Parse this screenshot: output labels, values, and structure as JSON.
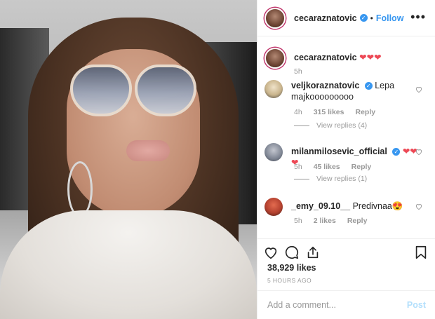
{
  "post": {
    "author": "cecaraznatovic",
    "verified_mark": "✓",
    "separator": "•",
    "follow_label": "Follow",
    "more_label": "•••",
    "caption_text": "❤❤❤",
    "caption_age": "5h"
  },
  "comments": [
    {
      "user": "veljkoraznatovic",
      "text": "Lepa majkooooooooo",
      "age": "4h",
      "likes": "315 likes",
      "reply": "Reply",
      "view_replies": "View replies (4)"
    },
    {
      "user": "milanmilosevic_official",
      "text": "❤❤❤",
      "age": "5h",
      "likes": "45 likes",
      "reply": "Reply",
      "view_replies": "View replies (1)"
    },
    {
      "user": "_emy_09.10__",
      "text": "Predivnaa😍",
      "age": "5h",
      "likes": "2 likes",
      "reply": "Reply"
    }
  ],
  "stats": {
    "likes": "38,929 likes",
    "time_ago": "5 HOURS AGO"
  },
  "add_comment": {
    "placeholder": "Add a comment...",
    "post_label": "Post"
  },
  "icons": [
    "heart-icon",
    "comment-icon",
    "share-icon",
    "bookmark-icon",
    "verified-icon",
    "more-icon"
  ],
  "colors": {
    "accent": "#3897f0",
    "heart": "#ed4956",
    "muted": "#999999",
    "post_disabled": "#b2dffc"
  }
}
